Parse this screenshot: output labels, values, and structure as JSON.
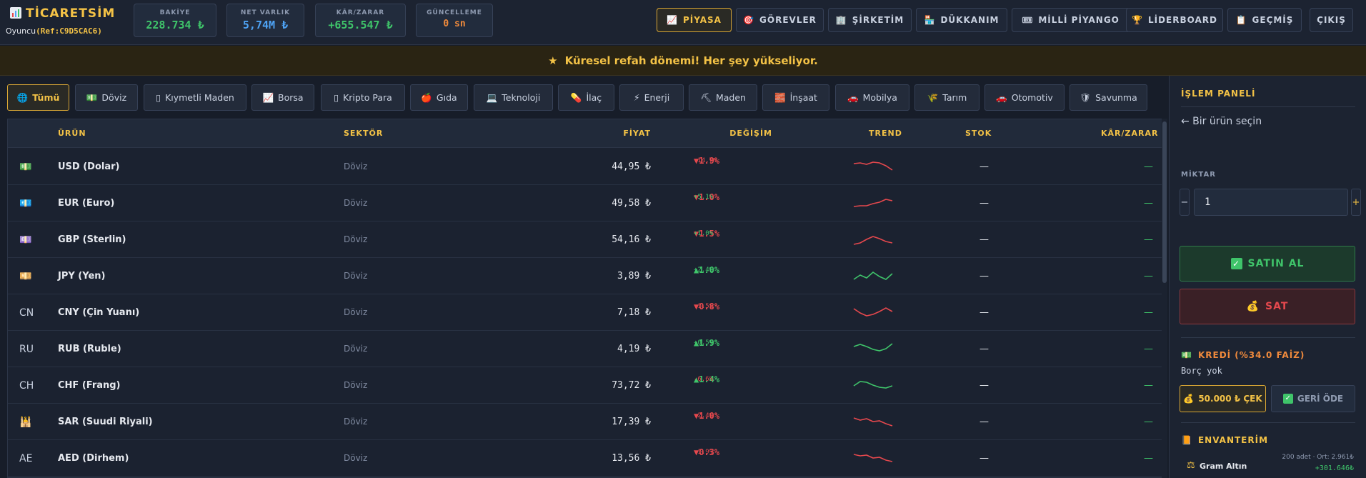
{
  "app": {
    "title": "TİCARETSİM",
    "player_prefix": "Oyuncu",
    "player_ref": "(Ref:C9D5CAC6)"
  },
  "stats": {
    "balance": {
      "label": "BAKİYE",
      "value": "228.734 ₺"
    },
    "net": {
      "label": "NET VARLIK",
      "value": "5,74M ₺"
    },
    "pl": {
      "label": "KÂR/ZARAR",
      "value": "+655.547 ₺"
    },
    "update": {
      "label": "GÜNCELLEME",
      "value": "0 sn"
    }
  },
  "nav": [
    {
      "icon": "📈",
      "label": "PİYASA"
    },
    {
      "icon": "🎯",
      "label": "GÖREVLER"
    },
    {
      "icon": "🏢",
      "label": "ŞİRKETİM"
    },
    {
      "icon": "🏪",
      "label": "DÜKKANIM"
    },
    {
      "icon": "🎟",
      "label": "MİLLİ PİYANGO"
    },
    {
      "icon": "🏆",
      "label": "LİDERBOARD"
    },
    {
      "icon": "📋",
      "label": "GEÇMİŞ"
    },
    {
      "icon": "",
      "label": "ÇIKIŞ"
    }
  ],
  "banner": {
    "icon": "★",
    "text": "Küresel refah dönemi! Her şey yükseliyor."
  },
  "filters": [
    {
      "icon": "🌐",
      "label": "Tümü"
    },
    {
      "icon": "💵",
      "label": "Döviz"
    },
    {
      "icon": "▯",
      "label": "Kıymetli Maden"
    },
    {
      "icon": "📈",
      "label": "Borsa"
    },
    {
      "icon": "▯",
      "label": "Kripto Para"
    },
    {
      "icon": "🍎",
      "label": "Gıda"
    },
    {
      "icon": "💻",
      "label": "Teknoloji"
    },
    {
      "icon": "💊",
      "label": "İlaç"
    },
    {
      "icon": "⚡",
      "label": "Enerji"
    },
    {
      "icon": "⛏",
      "label": "Maden"
    },
    {
      "icon": "🧱",
      "label": "İnşaat"
    },
    {
      "icon": "🚗",
      "label": "Mobilya"
    },
    {
      "icon": "🌾",
      "label": "Tarım"
    },
    {
      "icon": "🚗",
      "label": "Otomotiv"
    },
    {
      "icon": "🛡",
      "label": "Savunma"
    }
  ],
  "table": {
    "headers": [
      "ÜRÜN",
      "SEKTÖR",
      "FİYAT",
      "DEĞİŞİM",
      "TREND",
      "STOK",
      "KÂR/ZARAR"
    ],
    "rows": [
      {
        "icon": "💵",
        "name": "USD (Dolar)",
        "sector": "Döviz",
        "price": "44,95 ₺",
        "change": "▼1.9%",
        "sub": "-14.7%",
        "dir": "down",
        "subdir": "down",
        "stock": "—",
        "pl": "—",
        "trend": [
          5,
          4,
          6,
          3,
          4,
          8,
          14
        ]
      },
      {
        "icon": "💶",
        "name": "EUR (Euro)",
        "sector": "Döviz",
        "price": "49,58 ₺",
        "change": "▼1.0%",
        "sub": "+5.1%",
        "dir": "down",
        "subdir": "up",
        "stock": "—",
        "pl": "—",
        "trend": [
          14,
          13,
          13,
          10,
          8,
          4,
          6
        ]
      },
      {
        "icon": "💷",
        "name": "GBP (Sterlin)",
        "sector": "Döviz",
        "price": "54,16 ₺",
        "change": "▼1.5%",
        "sub": "+1.0%",
        "dir": "down",
        "subdir": "up",
        "stock": "—",
        "pl": "—",
        "trend": [
          16,
          14,
          9,
          5,
          8,
          12,
          14
        ]
      },
      {
        "icon": "💴",
        "name": "JPY (Yen)",
        "sector": "Döviz",
        "price": "3,89 ₺",
        "change": "▲1.0%",
        "sub": "+2.4%",
        "dir": "up",
        "subdir": "up",
        "stock": "—",
        "pl": "—",
        "trend": [
          14,
          8,
          12,
          4,
          10,
          14,
          6
        ]
      },
      {
        "icon": "CN",
        "name": "CNY (Çin Yuanı)",
        "sector": "Döviz",
        "price": "7,18 ₺",
        "change": "▼0.8%",
        "sub": "-1.5%",
        "dir": "down",
        "subdir": "down",
        "stock": "—",
        "pl": "—",
        "trend": [
          4,
          10,
          14,
          12,
          8,
          3,
          8
        ]
      },
      {
        "icon": "RU",
        "name": "RUB (Ruble)",
        "sector": "Döviz",
        "price": "4,19 ₺",
        "change": "▲1.9%",
        "sub": "+0.5%",
        "dir": "up",
        "subdir": "up",
        "stock": "—",
        "pl": "—",
        "trend": [
          6,
          3,
          6,
          10,
          12,
          9,
          2
        ]
      },
      {
        "icon": "CH",
        "name": "CHF (Frang)",
        "sector": "Döviz",
        "price": "73,72 ₺",
        "change": "▲1.4%",
        "sub": "-6.6%",
        "dir": "up",
        "subdir": "down",
        "stock": "—",
        "pl": "—",
        "trend": [
          10,
          4,
          5,
          9,
          12,
          13,
          10
        ]
      },
      {
        "icon": "🕌",
        "name": "SAR (Suudi Riyali)",
        "sector": "Döviz",
        "price": "17,39 ₺",
        "change": "▼1.0%",
        "sub": "-2.4%",
        "dir": "down",
        "subdir": "down",
        "stock": "—",
        "pl": "—",
        "trend": [
          4,
          7,
          5,
          9,
          8,
          12,
          15
        ]
      },
      {
        "icon": "AE",
        "name": "AED (Dirhem)",
        "sector": "Döviz",
        "price": "13,56 ₺",
        "change": "▼0.3%",
        "sub": "-1.9%",
        "dir": "down",
        "subdir": "down",
        "stock": "—",
        "pl": "—",
        "trend": [
          4,
          6,
          5,
          9,
          8,
          12,
          14
        ]
      }
    ]
  },
  "panel": {
    "title": "İŞLEM PANELİ",
    "select_prompt": "← Bir ürün seçin",
    "qty_label": "MİKTAR",
    "qty_value": "1",
    "minus": "−",
    "plus": "+",
    "buy": "SATIN AL",
    "sell": "SAT",
    "credit_title": "KREDİ (%34.0 FAİZ)",
    "debt": "Borç yok",
    "borrow": "50.000 ₺ ÇEK",
    "repay": "GERİ ÖDE",
    "inventory_title": "ENVANTERİM",
    "inv_item": "Gram Altın",
    "inv_meta": "200 adet · Ort: 2.961₺",
    "inv_pl": "+301.646₺"
  },
  "colors": {
    "accent": "#f3c246",
    "up": "#3fc46a",
    "down": "#e5484d",
    "info": "#4ea3f5"
  }
}
